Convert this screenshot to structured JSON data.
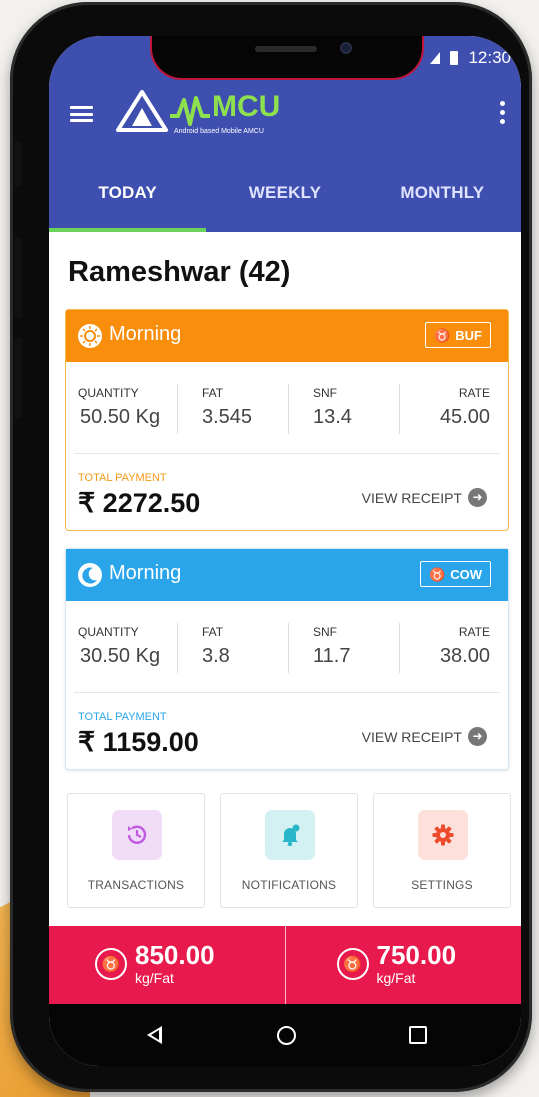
{
  "status": {
    "time": "12:30"
  },
  "app": {
    "logo_text": "MCU",
    "logo_sub": "Android based Mobile AMCU"
  },
  "tabs": [
    {
      "label": "TODAY",
      "active": true
    },
    {
      "label": "WEEKLY",
      "active": false
    },
    {
      "label": "MONTHLY",
      "active": false
    }
  ],
  "farmer": {
    "name": "Rameshwar (42)"
  },
  "cards": [
    {
      "shift": "Morning",
      "shift_icon": "sun-icon",
      "animal": "BUF",
      "animal_icon": "buffalo-icon",
      "accent": "#f98e0d",
      "stats": [
        {
          "label": "QUANTITY",
          "value": "50.50 Kg"
        },
        {
          "label": "FAT",
          "value": "3.545"
        },
        {
          "label": "SNF",
          "value": "13.4"
        },
        {
          "label": "RATE",
          "value": "45.00"
        }
      ],
      "payment_label": "TOTAL PAYMENT",
      "payment_value": "₹ 2272.50",
      "receipt_label": "VIEW RECEIPT"
    },
    {
      "shift": "Morning",
      "shift_icon": "moon-icon",
      "animal": "COW",
      "animal_icon": "cow-icon",
      "accent": "#2aa5ea",
      "stats": [
        {
          "label": "QUANTITY",
          "value": "30.50 Kg"
        },
        {
          "label": "FAT",
          "value": "3.8"
        },
        {
          "label": "SNF",
          "value": "11.7"
        },
        {
          "label": "RATE",
          "value": "38.00"
        }
      ],
      "payment_label": "TOTAL PAYMENT",
      "payment_value": "₹ 1159.00",
      "receipt_label": "VIEW RECEIPT"
    }
  ],
  "tiles": [
    {
      "label": "TRANSACTIONS",
      "icon": "history-icon",
      "color": "#c05ce0"
    },
    {
      "label": "NOTIFICATIONS",
      "icon": "bell-icon",
      "color": "#27b5c8"
    },
    {
      "label": "SETTINGS",
      "icon": "gear-icon",
      "color": "#ee4b2b"
    }
  ],
  "rates": [
    {
      "value": "850.00",
      "unit": "kg/Fat",
      "icon": "buffalo-icon"
    },
    {
      "value": "750.00",
      "unit": "kg/Fat",
      "icon": "cow-icon"
    }
  ]
}
